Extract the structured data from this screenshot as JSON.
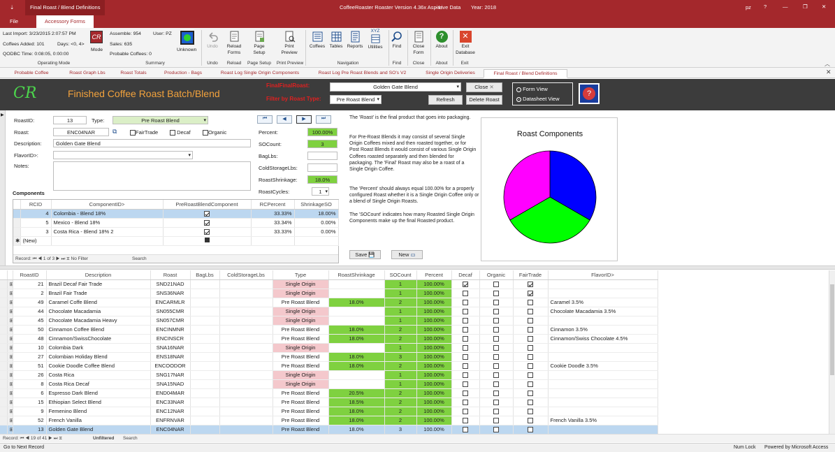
{
  "window": {
    "doc_title": "Final Roast / Blend Definitions",
    "app_title": "CoffeeRoaster Roaster Version 4.36x Aspire",
    "live": "- Live Data",
    "year": "Year: 2018",
    "user_short": "pz",
    "help": "?",
    "min": "—",
    "max": "❐",
    "close": "✕",
    "qat": "⇣"
  },
  "ribbon_tabs": [
    "File",
    "Accessory Forms"
  ],
  "status_info": {
    "last_import": "Last Import: 3/23/2015 2:07:57 PM",
    "coffees_added": "Coffees Added: 101",
    "days": "Days: <0, 4>",
    "qodbc": "QODBC Time: 0:08:05, 0:00:00",
    "assemble": "Assemble: 954",
    "user": "User: PZ",
    "sales": "Sales: 635",
    "probable": "Probable Coffees: 0",
    "unknown": "Unknown",
    "mode": "Mode",
    "cr": "CR"
  },
  "ribbon_buttons": {
    "undo": "Undo",
    "reload": "Reload Forms",
    "page_setup": "Page Setup",
    "print_preview": "Print Preview",
    "coffees": "Coffees",
    "tables": "Tables",
    "reports": "Reports",
    "utilities": "Utilities",
    "find": "Find",
    "close_form": "Close Form",
    "about": "About",
    "exit_db": "Exit Database",
    "xyz": "XYZ"
  },
  "ribbon_groups": [
    "Operating Mode",
    "Summary",
    "Undo",
    "Reload",
    "Page Setup",
    "Print Preview",
    "Navigation",
    "Find",
    "Close",
    "About",
    "Exit"
  ],
  "doc_tabs": [
    "Probable Coffee",
    "Roast Graph Lbs",
    "Roast Totals",
    "Production - Bags",
    "Roast Log Single Origin Components",
    "Roast Log Pre Roast Blends and SO's V2",
    "Single Origin Deliveries",
    "Final Roast / Blend Definitions"
  ],
  "form_header": {
    "logo": "CR",
    "title": "Finished Coffee Roast Batch/Blend",
    "final_label": "FinalFinalRoast:",
    "final_value": "Golden Gate Blend",
    "filter_label": "Filter by Roast Type:",
    "filter_value": "Pre Roast Blend",
    "close_btn": "Close",
    "refresh_btn": "Refresh",
    "delete_btn": "Delete Roast",
    "form_view": "Form View",
    "datasheet_view": "Datasheet View"
  },
  "record": {
    "roastid_label": "RoastID:",
    "roastid": "13",
    "type_label": "Type:",
    "type": "Pre Roast Blend",
    "roast_label": "Roast:",
    "roast": "ENC04NAR",
    "fairtrade": "FairTrade",
    "decaf": "Decaf",
    "organic": "Organic",
    "desc_label": "Description:",
    "description": "Golden Gate Blend",
    "flavor_label": "FlavorID>:",
    "notes_label": "Notes:",
    "percent_label": "Percent:",
    "percent": "100.00%",
    "socount_label": "SOCount:",
    "socount": "3",
    "baglbs_label": "BagLbs:",
    "cold_label": "ColdStorageLbs:",
    "shrink_label": "RoastShrinkage:",
    "shrink": "18.0%",
    "cycles_label": "RoastCycles:",
    "cycles": "1",
    "save": "Save",
    "new": "New"
  },
  "help_text": {
    "p1": "The 'Roast' is the final product that goes into packaging.",
    "p2": "For Pre-Roast Blends it may consist of several Single Origin Coffees mixed and then roasted together, or for Post Roast Blends it would consist of various Single Origin Coffees roasted separately and then blended for packaging. The 'Final' Roast may also be a roast of a Single Origin Coffee.",
    "p3": "The 'Percent' should always equal 100.00% for a properly configured Roast whether it is a Single Origin Coffee only or a blend of Single Origin Roasts.",
    "p4": "The 'SOCount' indicates how many Roasted Single Origin Components make up the final Roasted product."
  },
  "components": {
    "label": "Components",
    "headers": [
      "RCID",
      "ComponentID>",
      "PreRoastBlendComponent",
      "RCPercent",
      "ShrinkageSO"
    ],
    "rows": [
      {
        "rcid": "4",
        "component": "Colombia - Blend 18%",
        "pre": true,
        "pct": "33.33%",
        "shrink": "18.00%"
      },
      {
        "rcid": "5",
        "component": "Mexico - Blend 18%",
        "pre": true,
        "pct": "33.34%",
        "shrink": "0.00%"
      },
      {
        "rcid": "3",
        "component": "Costa Rica - Blend 18% 2",
        "pre": true,
        "pct": "33.33%",
        "shrink": "0.00%"
      }
    ],
    "new_row": "(New)",
    "nav": "Record: ⏮ ◀ 1 of 3 ▶ ⏭ ⧖ No Filter",
    "search": "Search"
  },
  "chart_data": {
    "type": "pie",
    "title": "Roast Components",
    "categories": [
      "Colombia - Blend 18%",
      "Mexico - Blend 18%",
      "Costa Rica - Blend 18% 2"
    ],
    "values": [
      33.33,
      33.34,
      33.33
    ],
    "colors": [
      "#0000ff",
      "#00ff00",
      "#ff00ff"
    ]
  },
  "datasheet": {
    "headers": [
      "RoastID",
      "Description",
      "Roast",
      "BagLbs",
      "ColdStorageLbs",
      "Type",
      "RoastShrinkage",
      "SOCount",
      "Percent",
      "Decaf",
      "Organic",
      "FairTrade",
      "FlavorID>"
    ],
    "rows": [
      {
        "id": "21",
        "desc": "Brazil Decaf Fair Trade",
        "roast": "SND21NAD",
        "type": "Single Origin",
        "shrink": "",
        "so": "1",
        "pct": "100.00%",
        "decaf": true,
        "organic": false,
        "fair": true,
        "flavor": ""
      },
      {
        "id": "2",
        "desc": "Brazil Fair Trade",
        "roast": "SNS36NAR",
        "type": "Single Origin",
        "shrink": "",
        "so": "1",
        "pct": "100.00%",
        "decaf": false,
        "organic": false,
        "fair": true,
        "flavor": ""
      },
      {
        "id": "49",
        "desc": "Caramel Coffe Blend",
        "roast": "ENCARMLR",
        "type": "Pre Roast Blend",
        "shrink": "18.0%",
        "so": "2",
        "pct": "100.00%",
        "decaf": false,
        "organic": false,
        "fair": false,
        "flavor": "Caramel 3.5%"
      },
      {
        "id": "44",
        "desc": "Chocolate Macadamia",
        "roast": "SN055CMR",
        "type": "Single Origin",
        "shrink": "",
        "so": "1",
        "pct": "100.00%",
        "decaf": false,
        "organic": false,
        "fair": false,
        "flavor": "Chocolate Macadamia 3.5%"
      },
      {
        "id": "45",
        "desc": "Chocolate Macadamia Heavy",
        "roast": "SN057CMR",
        "type": "Single Origin",
        "shrink": "",
        "so": "1",
        "pct": "100.00%",
        "decaf": false,
        "organic": false,
        "fair": false,
        "flavor": ""
      },
      {
        "id": "50",
        "desc": "Cinnamon Coffee Blend",
        "roast": "ENCINMNR",
        "type": "Pre Roast Blend",
        "shrink": "18.0%",
        "so": "2",
        "pct": "100.00%",
        "decaf": false,
        "organic": false,
        "fair": false,
        "flavor": "Cinnamon 3.5%"
      },
      {
        "id": "48",
        "desc": "Cinnamon/SwissChocolate",
        "roast": "ENCINSCR",
        "type": "Pre Roast Blend",
        "shrink": "18.0%",
        "so": "2",
        "pct": "100.00%",
        "decaf": false,
        "organic": false,
        "fair": false,
        "flavor": "Cinnamon/Swiss Chocolate 4.5%"
      },
      {
        "id": "10",
        "desc": "Colombia Dark",
        "roast": "SNA16NAR",
        "type": "Single Origin",
        "shrink": "",
        "so": "1",
        "pct": "100.00%",
        "decaf": false,
        "organic": false,
        "fair": false,
        "flavor": ""
      },
      {
        "id": "27",
        "desc": "Colombian Holiday Blend",
        "roast": "ENS18NAR",
        "type": "Pre Roast Blend",
        "shrink": "18.0%",
        "so": "3",
        "pct": "100.00%",
        "decaf": false,
        "organic": false,
        "fair": false,
        "flavor": ""
      },
      {
        "id": "51",
        "desc": "Cookie Doodle Coffee Blend",
        "roast": "ENCOODOR",
        "type": "Pre Roast Blend",
        "shrink": "18.0%",
        "so": "2",
        "pct": "100.00%",
        "decaf": false,
        "organic": false,
        "fair": false,
        "flavor": "Cookie Doodle 3.5%"
      },
      {
        "id": "26",
        "desc": "Costa Rica",
        "roast": "SNG17NAR",
        "type": "Single Origin",
        "shrink": "",
        "so": "1",
        "pct": "100.00%",
        "decaf": false,
        "organic": false,
        "fair": false,
        "flavor": ""
      },
      {
        "id": "8",
        "desc": "Costa Rica Decaf",
        "roast": "SNA15NAD",
        "type": "Single Origin",
        "shrink": "",
        "so": "1",
        "pct": "100.00%",
        "decaf": false,
        "organic": false,
        "fair": false,
        "flavor": ""
      },
      {
        "id": "6",
        "desc": "Espresso Dark Blend",
        "roast": "END04MAR",
        "type": "Pre Roast Blend",
        "shrink": "20.5%",
        "so": "2",
        "pct": "100.00%",
        "decaf": false,
        "organic": false,
        "fair": false,
        "flavor": ""
      },
      {
        "id": "15",
        "desc": "Ethiopian Select Blend",
        "roast": "ENC33NAR",
        "type": "Pre Roast Blend",
        "shrink": "18.5%",
        "so": "2",
        "pct": "100.00%",
        "decaf": false,
        "organic": false,
        "fair": false,
        "flavor": ""
      },
      {
        "id": "9",
        "desc": "Femenino Blend",
        "roast": "ENC12NAR",
        "type": "Pre Roast Blend",
        "shrink": "18.0%",
        "so": "2",
        "pct": "100.00%",
        "decaf": false,
        "organic": false,
        "fair": false,
        "flavor": ""
      },
      {
        "id": "52",
        "desc": "French Vanilla",
        "roast": "ENFRNVAR",
        "type": "Pre Roast Blend",
        "shrink": "18.0%",
        "so": "2",
        "pct": "100.00%",
        "decaf": false,
        "organic": false,
        "fair": false,
        "flavor": "French Vanilla 3.5%"
      },
      {
        "id": "13",
        "desc": "Golden Gate Blend",
        "roast": "ENC04NAR",
        "type": "Pre Roast Blend",
        "shrink": "18.0%",
        "so": "3",
        "pct": "100.00%",
        "decaf": false,
        "organic": false,
        "fair": false,
        "flavor": "",
        "selected": true
      }
    ],
    "nav_record": "Record: ⏮ ◀ 19 of 41 ▶ ⏭ ⧖",
    "unfiltered": "Unfiltered",
    "search": "Search"
  },
  "statusbar": {
    "left": "Go to Next Record",
    "numlock": "Num Lock",
    "powered": "Powered by Microsoft Access"
  }
}
